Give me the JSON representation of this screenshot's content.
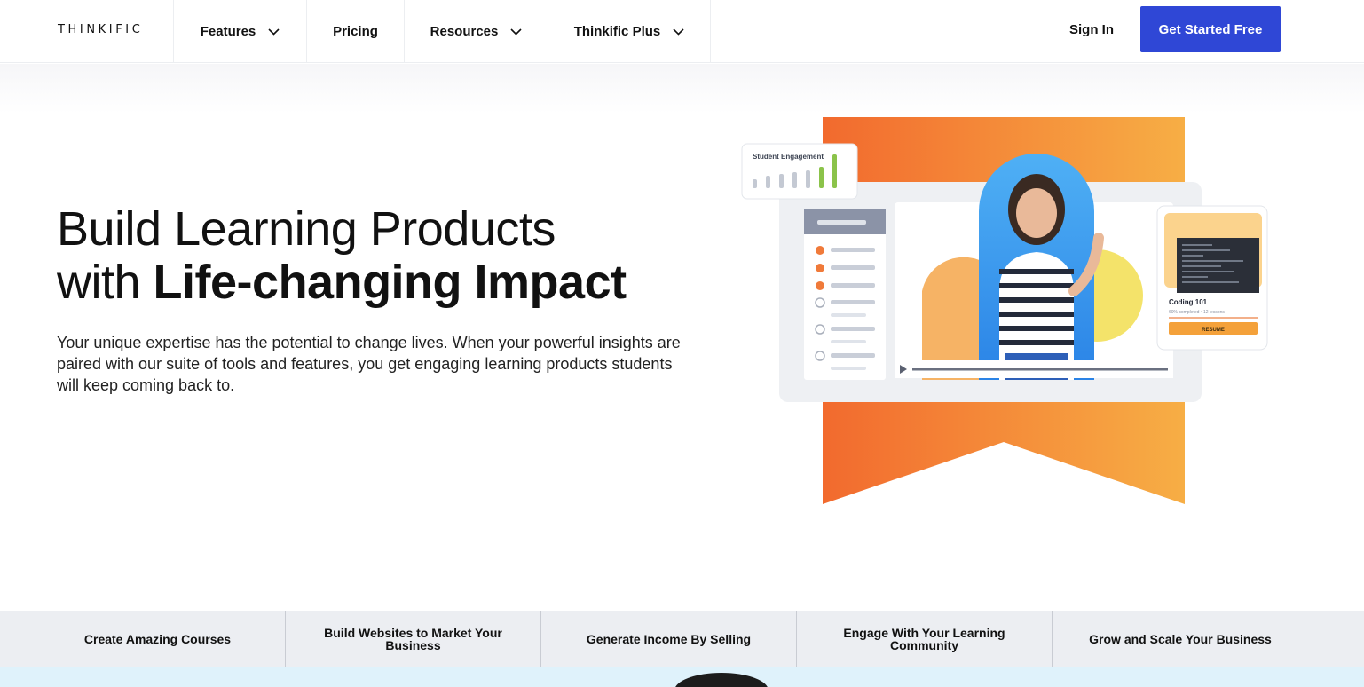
{
  "header": {
    "logo": "THINKIFIC",
    "nav": [
      {
        "label": "Features",
        "has_menu": true
      },
      {
        "label": "Pricing",
        "has_menu": false
      },
      {
        "label": "Resources",
        "has_menu": true
      },
      {
        "label": "Thinkific Plus",
        "has_menu": true
      }
    ],
    "sign_in": "Sign In",
    "cta": "Get Started Free"
  },
  "hero": {
    "title_line1": "Build Learning Products",
    "title_line2_light": "with",
    "title_line2_bold": "Life-changing Impact",
    "subtitle": "Your unique expertise has the potential to change lives. When your powerful insights are paired with our suite of tools and features, you get engaging learning products students will keep coming back to."
  },
  "illustration": {
    "engagement_label": "Student Engagement",
    "course_title": "Coding 101",
    "course_progress": "60% completed • 12 lessons",
    "resume_label": "RESUME"
  },
  "tabs": [
    "Create Amazing Courses",
    "Build Websites to Market Your Business",
    "Generate Income By Selling",
    "Engage With Your Learning Community",
    "Grow and Scale Your Business"
  ],
  "colors": {
    "brand_blue": "#2f47d6",
    "ribbon_start": "#f26a2e",
    "ribbon_end": "#f7ae45",
    "tab_bg": "#eceef2"
  }
}
